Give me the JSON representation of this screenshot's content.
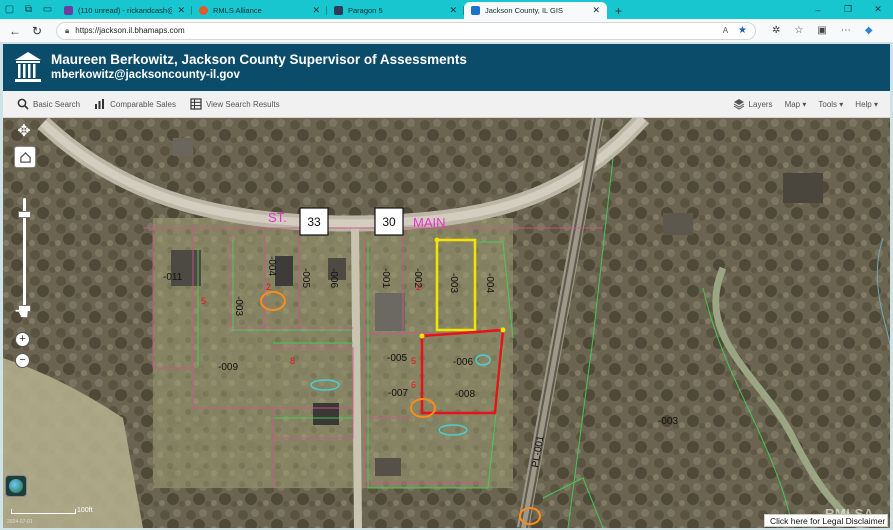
{
  "browser": {
    "tabs": [
      {
        "title": "(110 unread) - rickandcash@att.n",
        "favicon_color": "#6b3fa0",
        "active": false
      },
      {
        "title": "RMLS Alliance",
        "favicon_color": "#e05a2b",
        "active": false
      },
      {
        "title": "Paragon 5",
        "favicon_color": "#2a3b5c",
        "active": false
      },
      {
        "title": "Jackson County, IL GIS",
        "favicon_color": "#1a73c8",
        "active": true
      }
    ],
    "new_tab": "+",
    "window_controls": [
      "–",
      "❐",
      "✕"
    ],
    "url": "https://jackson.il.bhamaps.com"
  },
  "app": {
    "title": "Maureen Berkowitz, Jackson County Supervisor of Assessments",
    "subtitle": "mberkowitz@jacksoncounty-il.gov"
  },
  "toolbar": {
    "basic_search": "Basic Search",
    "comparable_sales": "Comparable Sales",
    "view_results": "View Search Results",
    "layers": "Layers",
    "map": "Map ▾",
    "tools": "Tools ▾",
    "help": "Help ▾"
  },
  "map": {
    "route_labels": [
      "33",
      "30"
    ],
    "street_st": "ST.",
    "street_main": "MAIN",
    "parcels": [
      "-011",
      "-003",
      "-004",
      "-005",
      "-006",
      "-001",
      "-002",
      "-003",
      "-004",
      "-009",
      "-005",
      "-006",
      "-007",
      "-008",
      "-003",
      "-001"
    ],
    "pl_label": "PL-001",
    "scale_label": "100ft",
    "date_stamp": "2024-07-01",
    "disclaimer": "Click here for Legal Disclaimer",
    "watermark": "RMLSA",
    "colors": {
      "header": "#0b4c6b",
      "tabstrip": "#18c6cf",
      "parcel_line": "#d4518f",
      "selected_yellow": "#f2e600",
      "selected_red": "#e8121a",
      "street_label": "#e632d3"
    }
  }
}
